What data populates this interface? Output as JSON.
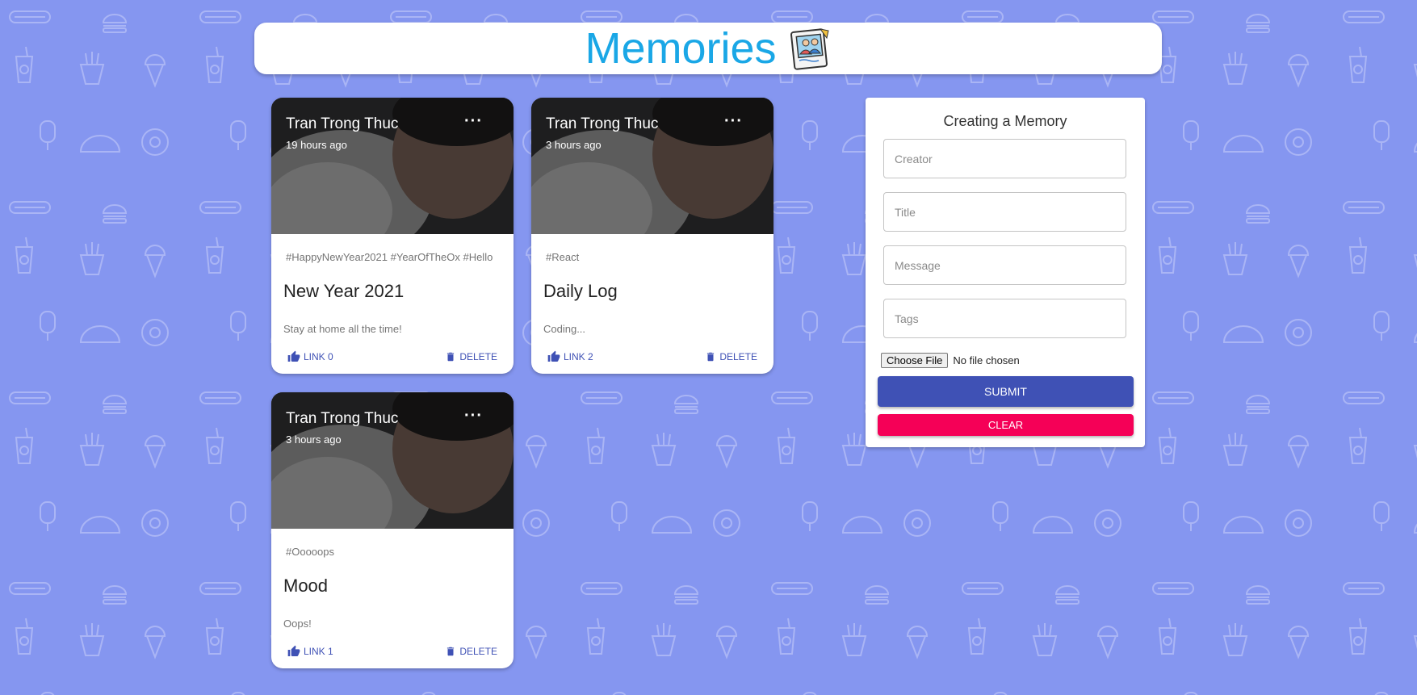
{
  "app": {
    "title": "Memories",
    "logo_icon": "photo-icon",
    "background_color": "#8596f0",
    "accent_color": "#1aa7e6"
  },
  "posts": [
    {
      "creator": "Tran Trong Thuc",
      "time": "19 hours ago",
      "tags": "#HappyNewYear2021 #YearOfTheOx #Hello",
      "title": "New Year 2021",
      "message": "Stay at home all the time!",
      "like_label": "LINK 0",
      "delete_label": "DELETE",
      "more_icon": "more-horiz-icon"
    },
    {
      "creator": "Tran Trong Thuc",
      "time": "3 hours ago",
      "tags": "#React",
      "title": "Daily Log",
      "message": "Coding...",
      "like_label": "LINK 2",
      "delete_label": "DELETE",
      "more_icon": "more-horiz-icon"
    },
    {
      "creator": "Tran Trong Thuc",
      "time": "3 hours ago",
      "tags": "#Ooooops",
      "title": "Mood",
      "message": "Oops!",
      "like_label": "LINK 1",
      "delete_label": "DELETE",
      "more_icon": "more-horiz-icon"
    }
  ],
  "form": {
    "title": "Creating a Memory",
    "creator_placeholder": "Creator",
    "title_placeholder": "Title",
    "message_placeholder": "Message",
    "tags_placeholder": "Tags",
    "choose_file_label": "Choose File",
    "file_status": "No file chosen",
    "submit_label": "SUBMIT",
    "clear_label": "CLEAR",
    "submit_color": "#3f51b5",
    "clear_color": "#f50057"
  }
}
